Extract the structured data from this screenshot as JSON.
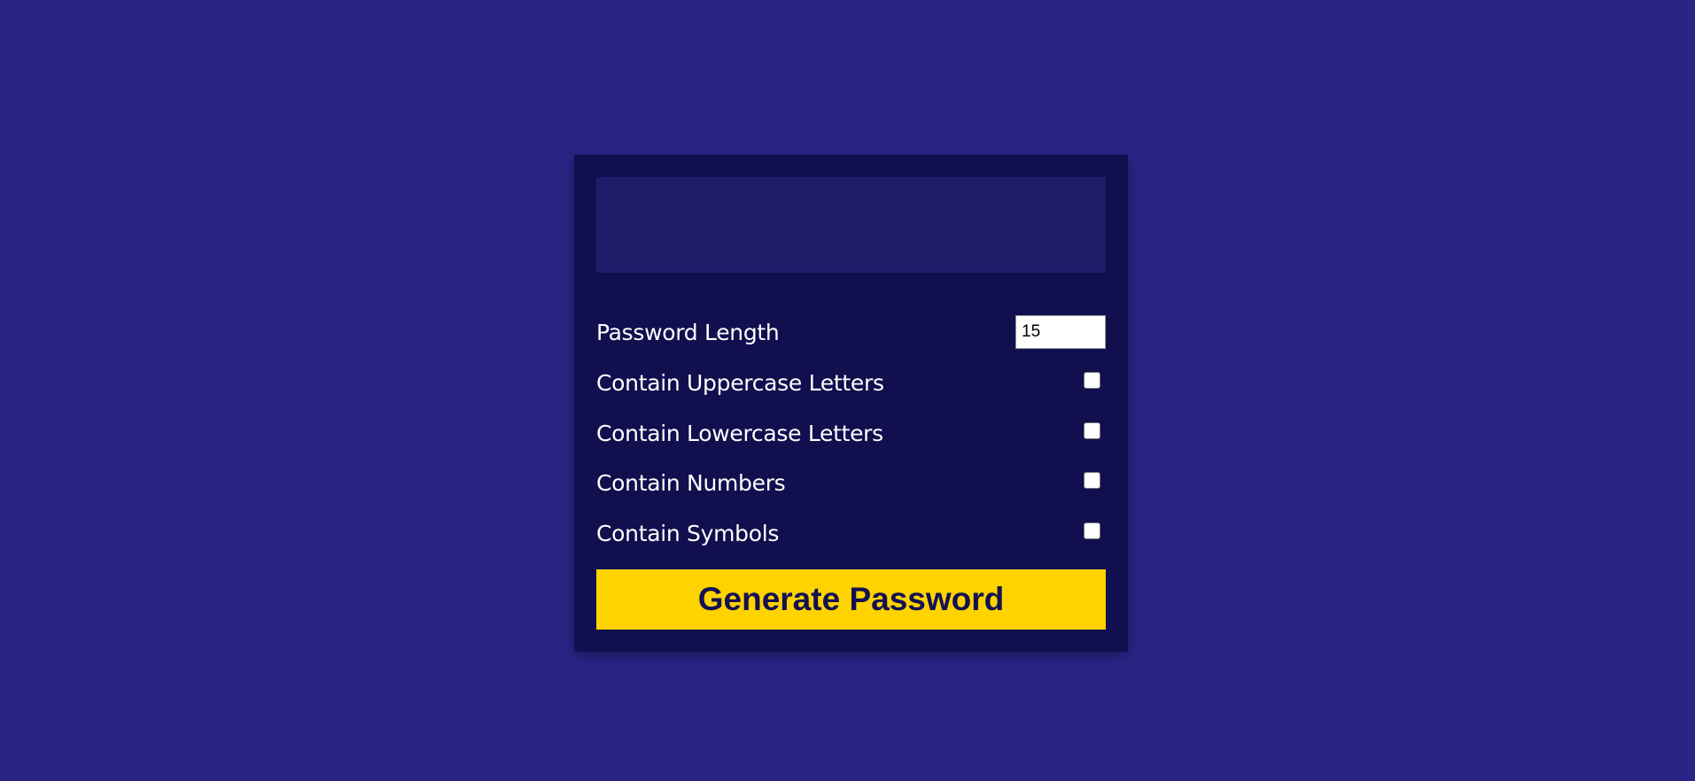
{
  "result": {
    "password": ""
  },
  "settings": {
    "length_label": "Password Length",
    "length_value": "15",
    "uppercase_label": "Contain Uppercase Letters",
    "lowercase_label": "Contain Lowercase Letters",
    "numbers_label": "Contain Numbers",
    "symbols_label": "Contain Symbols"
  },
  "generate_button": {
    "label": "Generate Password"
  },
  "colors": {
    "page_background": "#2a2486",
    "card_background": "#110f4e",
    "result_background": "#201c6a",
    "button_background": "#ffd300",
    "button_text": "#131152"
  }
}
